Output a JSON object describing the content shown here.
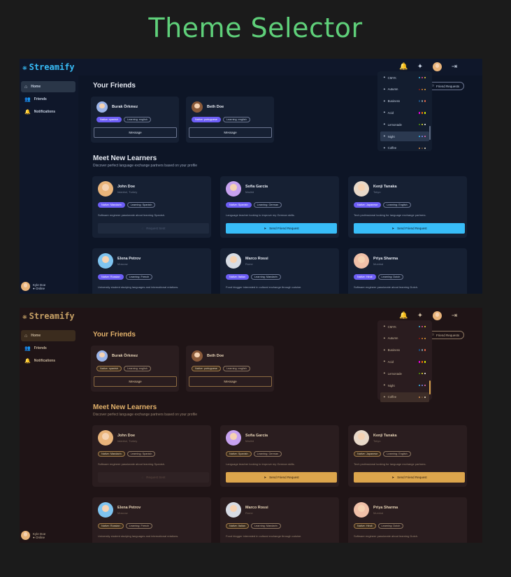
{
  "page_title": "Theme Selector",
  "app": {
    "logo": "Streamify",
    "nav": [
      {
        "label": "Home",
        "icon": "home-icon",
        "glyph": "⌂"
      },
      {
        "label": "Friends",
        "icon": "users-icon",
        "glyph": "👥"
      },
      {
        "label": "Notifications",
        "icon": "bell-icon",
        "glyph": "🔔"
      }
    ],
    "user": {
      "name": "Kyle Doe",
      "status": "● Online"
    },
    "friends_heading": "Your Friends",
    "friend_requests": "Friend Requests",
    "friends": [
      {
        "name": "Burak Örkmez",
        "native": "Native: spanish",
        "learning": "Learning: english",
        "button": "Message"
      },
      {
        "name": "Beth Doe",
        "native": "Native: portuguese",
        "learning": "Learning: english",
        "button": "Message"
      }
    ],
    "learners_heading": "Meet New Learners",
    "learners_sub": "Discover perfect language exchange partners based on your profile",
    "request_sent": "Request Sent",
    "send_request": "Send Friend Request",
    "learners": [
      {
        "name": "John Doe",
        "location": "Istanbul, Turkey",
        "native": "Native: Mandarin",
        "learning": "Learning: Spanish",
        "bio": "Software engineer passionate about learning Spanish."
      },
      {
        "name": "Sofia Garcia",
        "location": "Madrid",
        "native": "Native: Spanish",
        "learning": "Learning: German",
        "bio": "Language teacher looking to improve my German skills."
      },
      {
        "name": "Kenji Tanaka",
        "location": "Tokyo",
        "native": "Native: Japanese",
        "learning": "Learning: English",
        "bio": "Tech professional looking for language exchange partners."
      },
      {
        "name": "Elena Petrov",
        "location": "Moscow",
        "native": "Native: Russian",
        "learning": "Learning: French",
        "bio": "University student studying languages and international relations."
      },
      {
        "name": "Marco Rossi",
        "location": "Rome",
        "native": "Native: Italian",
        "learning": "Learning: Mandarin",
        "bio": "Food blogger interested in cultural exchange through cuisine."
      },
      {
        "name": "Priya Sharma",
        "location": "Mumbai",
        "native": "Native: Hindi",
        "learning": "Learning: Dutch",
        "bio": "Software engineer passionate about learning Dutch."
      }
    ],
    "themes": [
      {
        "label": "CMYK",
        "colors": [
          "#44bbe6",
          "#e84e92",
          "#f0d53a"
        ]
      },
      {
        "label": "Autumn",
        "colors": [
          "#8c1c13",
          "#d97a2b",
          "#e6a53a"
        ]
      },
      {
        "label": "Business",
        "colors": [
          "#1c4e80",
          "#7c909a",
          "#ea6947"
        ]
      },
      {
        "label": "Acid",
        "colors": [
          "#ff00f4",
          "#ff7400",
          "#eaff00"
        ]
      },
      {
        "label": "Lemonade",
        "colors": [
          "#519903",
          "#e9e92e",
          "#f6f6f6"
        ]
      },
      {
        "label": "Night",
        "colors": [
          "#38bdf8",
          "#818cf8",
          "#f471b5"
        ]
      },
      {
        "label": "Coffee",
        "colors": [
          "#db924b",
          "#6f4e37",
          "#f4e4c9"
        ]
      }
    ]
  },
  "screens": [
    {
      "theme": "Night",
      "active_theme_index": 5
    },
    {
      "theme": "Coffee",
      "active_theme_index": 6
    }
  ]
}
